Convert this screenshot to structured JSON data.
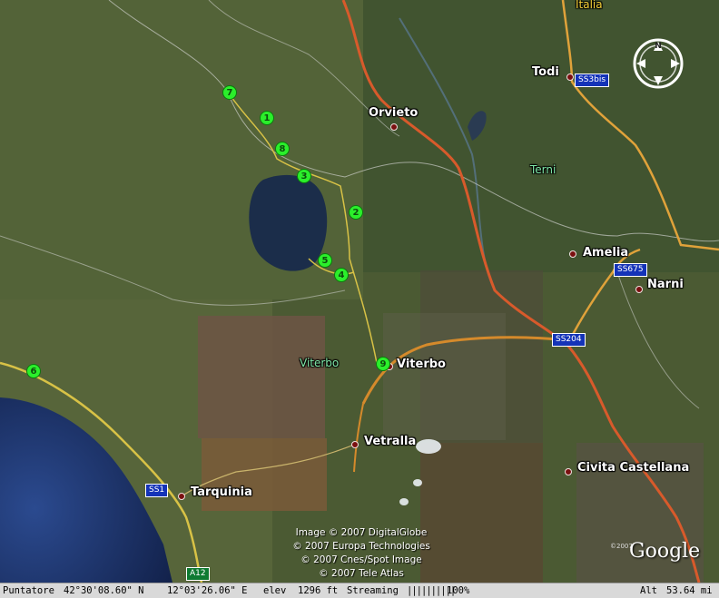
{
  "view": {
    "country_label": "Italia",
    "region_labels": [
      {
        "id": "terni",
        "text": "Terni"
      },
      {
        "id": "viterbo-region",
        "text": "Viterbo"
      }
    ],
    "cities": [
      {
        "id": "todi",
        "text": "Todi"
      },
      {
        "id": "orvieto",
        "text": "Orvieto"
      },
      {
        "id": "amelia",
        "text": "Amelia"
      },
      {
        "id": "narni",
        "text": "Narni"
      },
      {
        "id": "viterbo",
        "text": "Viterbo"
      },
      {
        "id": "vetralla",
        "text": "Vetralla"
      },
      {
        "id": "civita-castellana",
        "text": "Civita Castellana"
      },
      {
        "id": "tarquinia",
        "text": "Tarquinia"
      }
    ],
    "road_shields": [
      {
        "id": "ss3bis",
        "text": "SS3bis"
      },
      {
        "id": "ss675",
        "text": "SS675"
      },
      {
        "id": "ss204",
        "text": "SS204"
      },
      {
        "id": "ss1",
        "text": "SS1"
      },
      {
        "id": "a12",
        "text": "A12"
      }
    ],
    "placemarks": [
      {
        "id": "p1",
        "text": "1"
      },
      {
        "id": "p2",
        "text": "2"
      },
      {
        "id": "p3",
        "text": "3"
      },
      {
        "id": "p4",
        "text": "4"
      },
      {
        "id": "p5",
        "text": "5"
      },
      {
        "id": "p6",
        "text": "6"
      },
      {
        "id": "p7",
        "text": "7"
      },
      {
        "id": "p8",
        "text": "8"
      },
      {
        "id": "p9",
        "text": "9"
      }
    ],
    "compass_label": "N",
    "copyright_lines": [
      "Image © 2007 DigitalGlobe",
      "© 2007 Europa Technologies",
      "© 2007 Cnes/Spot Image",
      "© 2007 Tele Atlas"
    ],
    "small_copyright": "©2007",
    "brand_logo": "Google"
  },
  "status_bar": {
    "pointer_label": "Puntatore",
    "latitude": "42°30'08.60\" N",
    "longitude": "12°03'26.06\" E",
    "elev_label": "elev",
    "elevation": "1296 ft",
    "streaming_label": "Streaming",
    "streaming_bars": "||||||||||",
    "streaming_percent": "100%",
    "alt_label": "Alt",
    "altitude": "53.64 mi"
  },
  "colors": {
    "placemark": "#2bef2b",
    "road_major": "#d58a2b",
    "road_secondary": "#d8c246",
    "water": "#1b2d4a"
  }
}
